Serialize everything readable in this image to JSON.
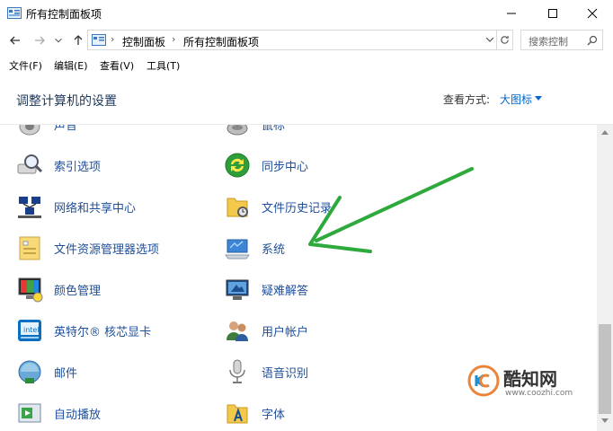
{
  "window": {
    "title": "所有控制面板项",
    "minimize_icon": "minimize-icon",
    "maximize_icon": "maximize-icon",
    "close_icon": "close-icon"
  },
  "address_bar": {
    "breadcrumbs": [
      "控制面板",
      "所有控制面板项"
    ],
    "search_placeholder": "搜索控制"
  },
  "menu": {
    "items": [
      "文件(F)",
      "编辑(E)",
      "查看(V)",
      "工具(T)"
    ]
  },
  "header": {
    "title": "调整计算机的设置",
    "view_by_label": "查看方式:",
    "view_by_value": "大图标"
  },
  "items": {
    "left": [
      {
        "label": "声音",
        "icon": "speaker-icon"
      },
      {
        "label": "索引选项",
        "icon": "indexing-icon"
      },
      {
        "label": "网络和共享中心",
        "icon": "network-icon"
      },
      {
        "label": "文件资源管理器选项",
        "icon": "folder-options-icon"
      },
      {
        "label": "颜色管理",
        "icon": "color-management-icon"
      },
      {
        "label": "英特尔® 核芯显卡",
        "icon": "intel-graphics-icon"
      },
      {
        "label": "邮件",
        "icon": "mail-icon"
      },
      {
        "label": "自动播放",
        "icon": "autoplay-icon"
      }
    ],
    "right": [
      {
        "label": "鼠标",
        "icon": "mouse-icon"
      },
      {
        "label": "同步中心",
        "icon": "sync-icon"
      },
      {
        "label": "文件历史记录",
        "icon": "file-history-icon"
      },
      {
        "label": "系统",
        "icon": "system-icon"
      },
      {
        "label": "疑难解答",
        "icon": "troubleshoot-icon"
      },
      {
        "label": "用户帐户",
        "icon": "user-accounts-icon"
      },
      {
        "label": "语音识别",
        "icon": "microphone-icon"
      },
      {
        "label": "字体",
        "icon": "fonts-icon"
      }
    ]
  },
  "watermark": {
    "brand": "酷知网",
    "url": "www.coozhi.com"
  },
  "colors": {
    "link": "#1f4f9a",
    "arrow": "#2eaa3c",
    "header_title": "#1e395b"
  }
}
